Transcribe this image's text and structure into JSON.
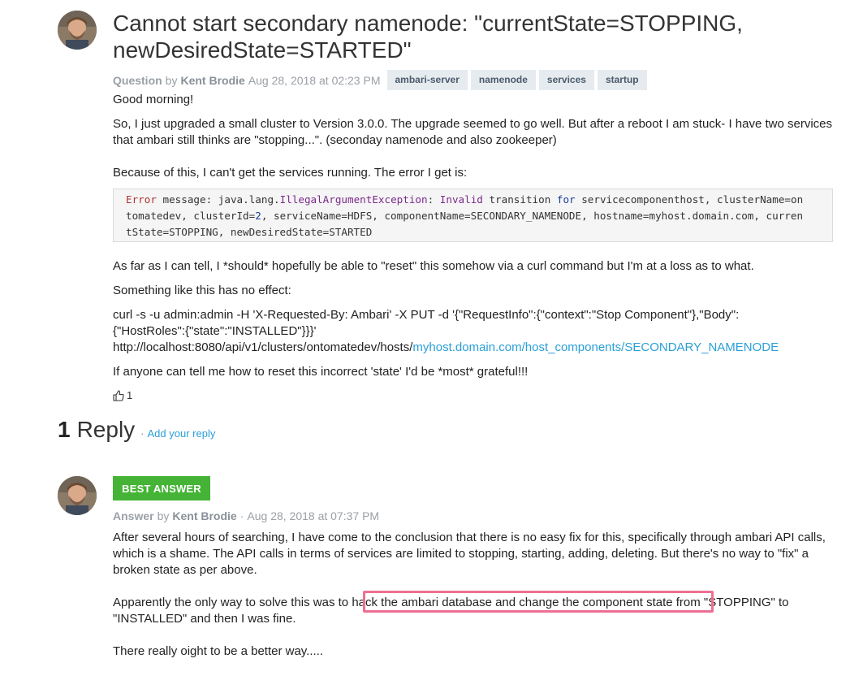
{
  "question": {
    "title": "Cannot start secondary namenode: \"currentState=STOPPING, newDesiredState=STARTED\"",
    "kind": "Question",
    "by": "by",
    "author": "Kent Brodie",
    "date": "Aug 28, 2018 at 02:23 PM",
    "tags": [
      "ambari-server",
      "namenode",
      "services",
      "startup"
    ],
    "p1": "Good morning!",
    "p2": "So, I just upgraded a small cluster to Version 3.0.0. The upgrade seemed to go well. But after a reboot I am stuck- I have two services that ambari still thinks are \"stopping...\". (seconday namenode and also zookeeper)",
    "p3": "Because of this, I can't get the services running. The error I get is:",
    "code": {
      "error_label": "Error",
      "w_message": "message:",
      "w_pkg": "java.lang.",
      "w_exc": "IllegalArgumentException",
      "w_colon": ":",
      "w_invalid": "Invalid",
      "w_transition": "transition",
      "w_for": "for",
      "w_rest1": "servicecomponenthost, clusterName=on",
      "line2a": "tomatedev, clusterId=",
      "line2num": "2",
      "line2b": ", serviceName=HDFS, componentName=SECONDARY_NAMENODE, hostname=myhost.domain.com, curren",
      "line3": "tState=STOPPING, newDesiredState=STARTED"
    },
    "p4": "As far as I can tell, I *should* hopefully be able to \"reset\" this somehow via a curl command but I'm at a loss as to what.",
    "p5": "Something like this has no effect:",
    "curl_line1": "curl -s -u admin:admin -H 'X-Requested-By: Ambari' -X PUT -d '{\"RequestInfo\":{\"context\":\"Stop Component\"},\"Body\":",
    "curl_line2": "{\"HostRoles\":{\"state\":\"INSTALLED\"}}}'",
    "curl_line3_plain": "http://localhost:8080/api/v1/clusters/ontomatedev/hosts/",
    "curl_line3_link": "myhost.domain.com/host_components/SECONDARY_NAMENODE",
    "p6": "If anyone can tell me how to reset this incorrect 'state' I'd be *most* grateful!!!",
    "votes": "1"
  },
  "replies": {
    "count": "1",
    "word": "Reply",
    "dot": "·",
    "add_label": "Add your reply"
  },
  "answer": {
    "badge": "BEST ANSWER",
    "kind": "Answer",
    "by": "by",
    "author": "Kent Brodie",
    "dot": "·",
    "date": "Aug 28, 2018 at 07:37 PM",
    "p1": "After several hours of searching, I have come to the conclusion that there is no easy fix for this, specifically through ambari API calls, which is a shame. The API calls in terms of services are limited to stopping, starting, adding, deleting. But there's no way to \"fix\" a broken state as per above.",
    "p2": "Apparently the only way to solve this was to hack the ambari database and change the component state from \"STOPPING\" to \"INSTALLED\" and then I was fine.",
    "p3": "There really oight to be a better way....."
  },
  "colors": {
    "link": "#2a9fd6",
    "best_answer_bg": "#45b436",
    "highlight_border": "#ee6f93",
    "tag_bg": "#e6ebef"
  }
}
